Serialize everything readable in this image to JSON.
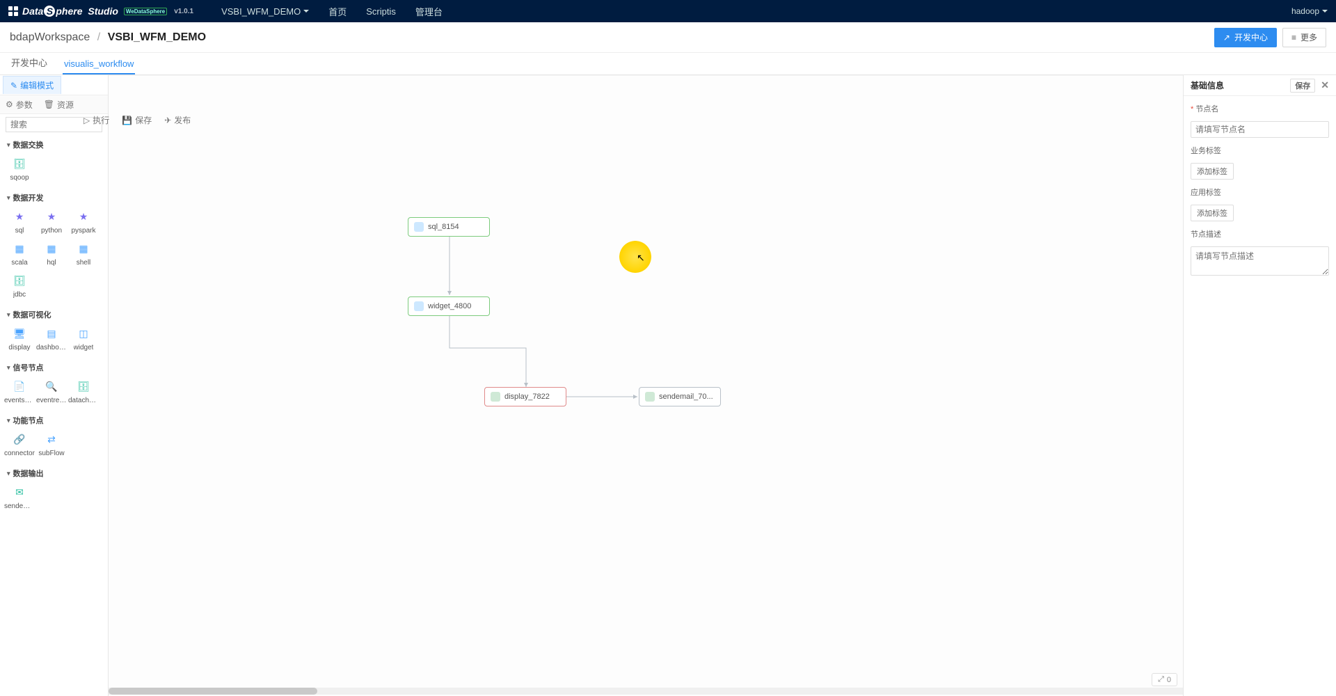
{
  "header": {
    "brand_1": "Data",
    "brand_2": "phere",
    "brand_3": "Studio",
    "badge": "WeDataSphere",
    "version": "v1.0.1",
    "project_selector": "VSBI_WFM_DEMO",
    "nav": {
      "home": "首页",
      "scriptis": "Scriptis",
      "console": "管理台"
    },
    "user": "hadoop"
  },
  "breadcrumb": {
    "workspace": "bdapWorkspace",
    "sep": "/",
    "project": "VSBI_WFM_DEMO"
  },
  "action_buttons": {
    "dev_center": "开发中心",
    "more": "更多"
  },
  "tabs": {
    "dev_center": "开发中心",
    "workflow": "visualis_workflow"
  },
  "mode_button": "编辑模式",
  "toolbar": {
    "params": "参数",
    "resource": "资源",
    "run": "执行",
    "save": "保存",
    "publish": "发布"
  },
  "search_placeholder": "搜索",
  "palette": {
    "cat_exchange": "数据交换",
    "exchange": [
      {
        "label": "sqoop"
      }
    ],
    "cat_dev": "数据开发",
    "dev": [
      {
        "label": "sql"
      },
      {
        "label": "python"
      },
      {
        "label": "pyspark"
      },
      {
        "label": "scala"
      },
      {
        "label": "hql"
      },
      {
        "label": "shell"
      },
      {
        "label": "jdbc"
      }
    ],
    "cat_vis": "数据可视化",
    "vis": [
      {
        "label": "display"
      },
      {
        "label": "dashboard"
      },
      {
        "label": "widget"
      }
    ],
    "cat_signal": "信号节点",
    "signal": [
      {
        "label": "eventsen..."
      },
      {
        "label": "eventrec..."
      },
      {
        "label": "datachec..."
      }
    ],
    "cat_func": "功能节点",
    "func": [
      {
        "label": "connector"
      },
      {
        "label": "subFlow"
      }
    ],
    "cat_out": "数据输出",
    "out": [
      {
        "label": "sendemail"
      }
    ]
  },
  "canvas": {
    "nodes": {
      "n1": "sql_8154",
      "n2": "widget_4800",
      "n3": "display_7822",
      "n4": "sendemail_70..."
    }
  },
  "right_panel": {
    "title": "基础信息",
    "save": "保存",
    "node_name_label": "节点名",
    "node_name_placeholder": "请填写节点名",
    "biz_tag_label": "业务标签",
    "add_tag": "添加标签",
    "app_tag_label": "应用标签",
    "desc_label": "节点描述",
    "desc_placeholder": "请填写节点描述"
  },
  "zoom": {
    "value": "0"
  }
}
